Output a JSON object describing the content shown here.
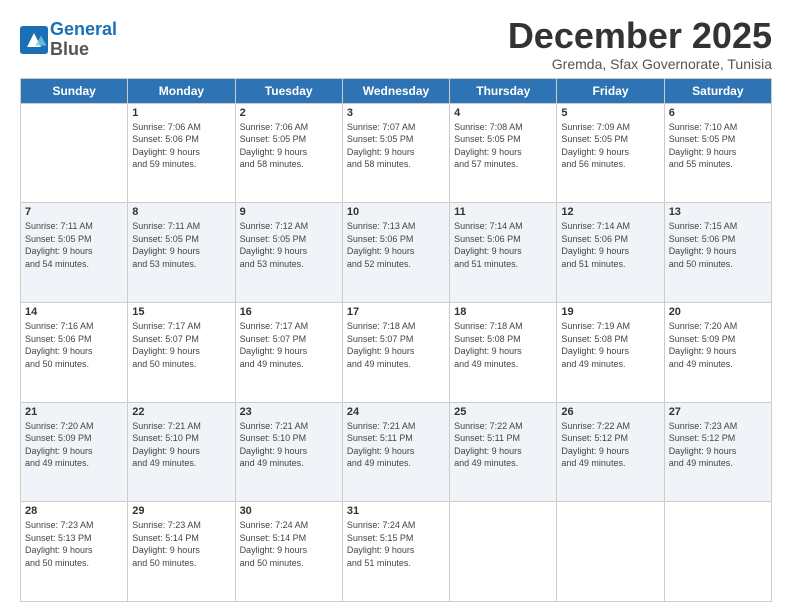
{
  "header": {
    "logo_line1": "General",
    "logo_line2": "Blue",
    "month": "December 2025",
    "location": "Gremda, Sfax Governorate, Tunisia"
  },
  "weekdays": [
    "Sunday",
    "Monday",
    "Tuesday",
    "Wednesday",
    "Thursday",
    "Friday",
    "Saturday"
  ],
  "weeks": [
    [
      {
        "day": "",
        "info": ""
      },
      {
        "day": "1",
        "info": "Sunrise: 7:06 AM\nSunset: 5:06 PM\nDaylight: 9 hours\nand 59 minutes."
      },
      {
        "day": "2",
        "info": "Sunrise: 7:06 AM\nSunset: 5:05 PM\nDaylight: 9 hours\nand 58 minutes."
      },
      {
        "day": "3",
        "info": "Sunrise: 7:07 AM\nSunset: 5:05 PM\nDaylight: 9 hours\nand 58 minutes."
      },
      {
        "day": "4",
        "info": "Sunrise: 7:08 AM\nSunset: 5:05 PM\nDaylight: 9 hours\nand 57 minutes."
      },
      {
        "day": "5",
        "info": "Sunrise: 7:09 AM\nSunset: 5:05 PM\nDaylight: 9 hours\nand 56 minutes."
      },
      {
        "day": "6",
        "info": "Sunrise: 7:10 AM\nSunset: 5:05 PM\nDaylight: 9 hours\nand 55 minutes."
      }
    ],
    [
      {
        "day": "7",
        "info": "Sunrise: 7:11 AM\nSunset: 5:05 PM\nDaylight: 9 hours\nand 54 minutes."
      },
      {
        "day": "8",
        "info": "Sunrise: 7:11 AM\nSunset: 5:05 PM\nDaylight: 9 hours\nand 53 minutes."
      },
      {
        "day": "9",
        "info": "Sunrise: 7:12 AM\nSunset: 5:05 PM\nDaylight: 9 hours\nand 53 minutes."
      },
      {
        "day": "10",
        "info": "Sunrise: 7:13 AM\nSunset: 5:06 PM\nDaylight: 9 hours\nand 52 minutes."
      },
      {
        "day": "11",
        "info": "Sunrise: 7:14 AM\nSunset: 5:06 PM\nDaylight: 9 hours\nand 51 minutes."
      },
      {
        "day": "12",
        "info": "Sunrise: 7:14 AM\nSunset: 5:06 PM\nDaylight: 9 hours\nand 51 minutes."
      },
      {
        "day": "13",
        "info": "Sunrise: 7:15 AM\nSunset: 5:06 PM\nDaylight: 9 hours\nand 50 minutes."
      }
    ],
    [
      {
        "day": "14",
        "info": "Sunrise: 7:16 AM\nSunset: 5:06 PM\nDaylight: 9 hours\nand 50 minutes."
      },
      {
        "day": "15",
        "info": "Sunrise: 7:17 AM\nSunset: 5:07 PM\nDaylight: 9 hours\nand 50 minutes."
      },
      {
        "day": "16",
        "info": "Sunrise: 7:17 AM\nSunset: 5:07 PM\nDaylight: 9 hours\nand 49 minutes."
      },
      {
        "day": "17",
        "info": "Sunrise: 7:18 AM\nSunset: 5:07 PM\nDaylight: 9 hours\nand 49 minutes."
      },
      {
        "day": "18",
        "info": "Sunrise: 7:18 AM\nSunset: 5:08 PM\nDaylight: 9 hours\nand 49 minutes."
      },
      {
        "day": "19",
        "info": "Sunrise: 7:19 AM\nSunset: 5:08 PM\nDaylight: 9 hours\nand 49 minutes."
      },
      {
        "day": "20",
        "info": "Sunrise: 7:20 AM\nSunset: 5:09 PM\nDaylight: 9 hours\nand 49 minutes."
      }
    ],
    [
      {
        "day": "21",
        "info": "Sunrise: 7:20 AM\nSunset: 5:09 PM\nDaylight: 9 hours\nand 49 minutes."
      },
      {
        "day": "22",
        "info": "Sunrise: 7:21 AM\nSunset: 5:10 PM\nDaylight: 9 hours\nand 49 minutes."
      },
      {
        "day": "23",
        "info": "Sunrise: 7:21 AM\nSunset: 5:10 PM\nDaylight: 9 hours\nand 49 minutes."
      },
      {
        "day": "24",
        "info": "Sunrise: 7:21 AM\nSunset: 5:11 PM\nDaylight: 9 hours\nand 49 minutes."
      },
      {
        "day": "25",
        "info": "Sunrise: 7:22 AM\nSunset: 5:11 PM\nDaylight: 9 hours\nand 49 minutes."
      },
      {
        "day": "26",
        "info": "Sunrise: 7:22 AM\nSunset: 5:12 PM\nDaylight: 9 hours\nand 49 minutes."
      },
      {
        "day": "27",
        "info": "Sunrise: 7:23 AM\nSunset: 5:12 PM\nDaylight: 9 hours\nand 49 minutes."
      }
    ],
    [
      {
        "day": "28",
        "info": "Sunrise: 7:23 AM\nSunset: 5:13 PM\nDaylight: 9 hours\nand 50 minutes."
      },
      {
        "day": "29",
        "info": "Sunrise: 7:23 AM\nSunset: 5:14 PM\nDaylight: 9 hours\nand 50 minutes."
      },
      {
        "day": "30",
        "info": "Sunrise: 7:24 AM\nSunset: 5:14 PM\nDaylight: 9 hours\nand 50 minutes."
      },
      {
        "day": "31",
        "info": "Sunrise: 7:24 AM\nSunset: 5:15 PM\nDaylight: 9 hours\nand 51 minutes."
      },
      {
        "day": "",
        "info": ""
      },
      {
        "day": "",
        "info": ""
      },
      {
        "day": "",
        "info": ""
      }
    ]
  ]
}
